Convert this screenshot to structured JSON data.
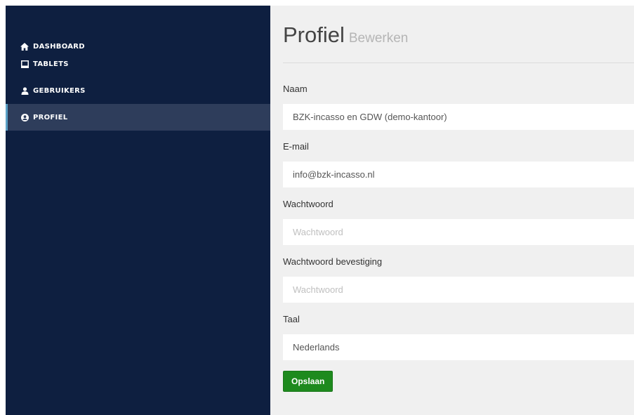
{
  "sidebar": {
    "items": [
      {
        "label": "DASHBOARD",
        "icon": "home-icon"
      },
      {
        "label": "TABLETS",
        "icon": "tablet-icon"
      },
      {
        "label": "GEBRUIKERS",
        "icon": "user-icon"
      },
      {
        "label": "PROFIEL",
        "icon": "user-circle-icon",
        "active": true
      }
    ]
  },
  "header": {
    "title": "Profiel",
    "subtitle": "Bewerken"
  },
  "form": {
    "name": {
      "label": "Naam",
      "value": "BZK-incasso en GDW (demo-kantoor)"
    },
    "email": {
      "label": "E-mail",
      "value": "info@bzk-incasso.nl"
    },
    "password": {
      "label": "Wachtwoord",
      "placeholder": "Wachtwoord"
    },
    "password_confirm": {
      "label": "Wachtwoord bevestiging",
      "placeholder": "Wachtwoord"
    },
    "language": {
      "label": "Taal",
      "value": "Nederlands"
    },
    "save_label": "Opslaan"
  },
  "colors": {
    "sidebar_bg": "#0e1f40",
    "sidebar_active_bg": "#2e3d5b",
    "active_indicator": "#5aa0c6",
    "main_bg": "#f0f0f0",
    "save_button": "#1e8a1e"
  }
}
